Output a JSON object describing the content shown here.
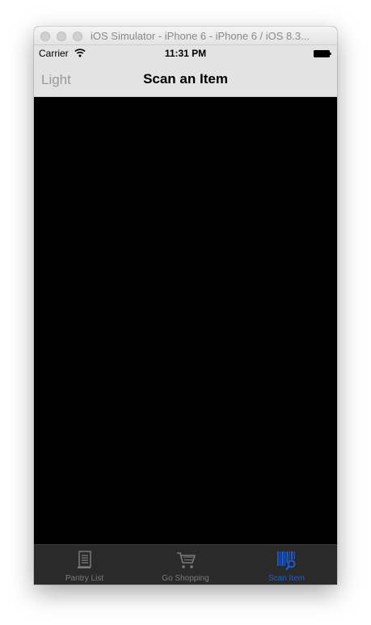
{
  "window": {
    "title": "iOS Simulator - iPhone 6 - iPhone 6 / iOS 8.3..."
  },
  "statusbar": {
    "carrier": "Carrier",
    "time": "11:31 PM"
  },
  "navbar": {
    "left_label": "Light",
    "title": "Scan an Item"
  },
  "tabs": [
    {
      "label": "Pantry List",
      "icon": "list-document-icon",
      "active": false
    },
    {
      "label": "Go Shopping",
      "icon": "shopping-cart-icon",
      "active": false
    },
    {
      "label": "Scan Item",
      "icon": "barcode-scan-icon",
      "active": true
    }
  ],
  "colors": {
    "active_tab": "#1a5fe0",
    "inactive_tab": "#7a7a7a",
    "tabbar": "#2a2a2a",
    "bars": "#e3e3e3"
  }
}
